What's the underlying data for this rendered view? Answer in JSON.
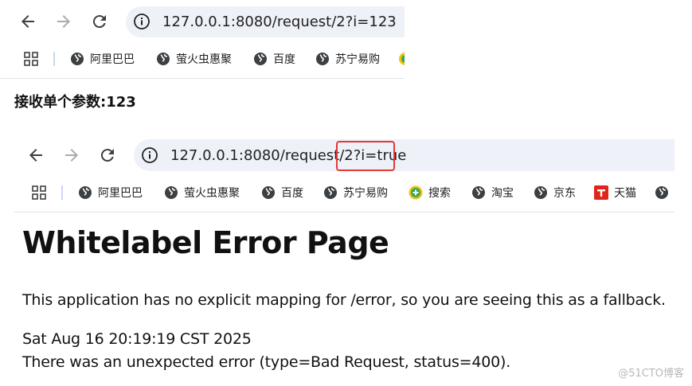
{
  "browser_top": {
    "url": "127.0.0.1:8080/request/2?i=123",
    "bookmarks": [
      "阿里巴巴",
      "萤火虫惠聚",
      "百度",
      "苏宁易购"
    ]
  },
  "top_page": {
    "message": "接收单个参数:123"
  },
  "browser_bottom": {
    "url": "127.0.0.1:8080/request/2?i=true",
    "bookmarks": [
      "阿里巴巴",
      "萤火虫惠聚",
      "百度",
      "苏宁易购",
      "搜索",
      "淘宝",
      "京东",
      "天猫"
    ]
  },
  "error_page": {
    "title": "Whitelabel Error Page",
    "description": "This application has no explicit mapping for /error, so you are seeing this as a fallback.",
    "timestamp": "Sat Aug 16 20:19:19 CST 2025",
    "error": "There was an unexpected error (type=Bad Request, status=400)."
  },
  "watermark": "@51CTO博客",
  "colors": {
    "omnibox_bg": "#eef1f8",
    "highlight_border": "#e53935",
    "nav_icon": "#5f6368"
  }
}
